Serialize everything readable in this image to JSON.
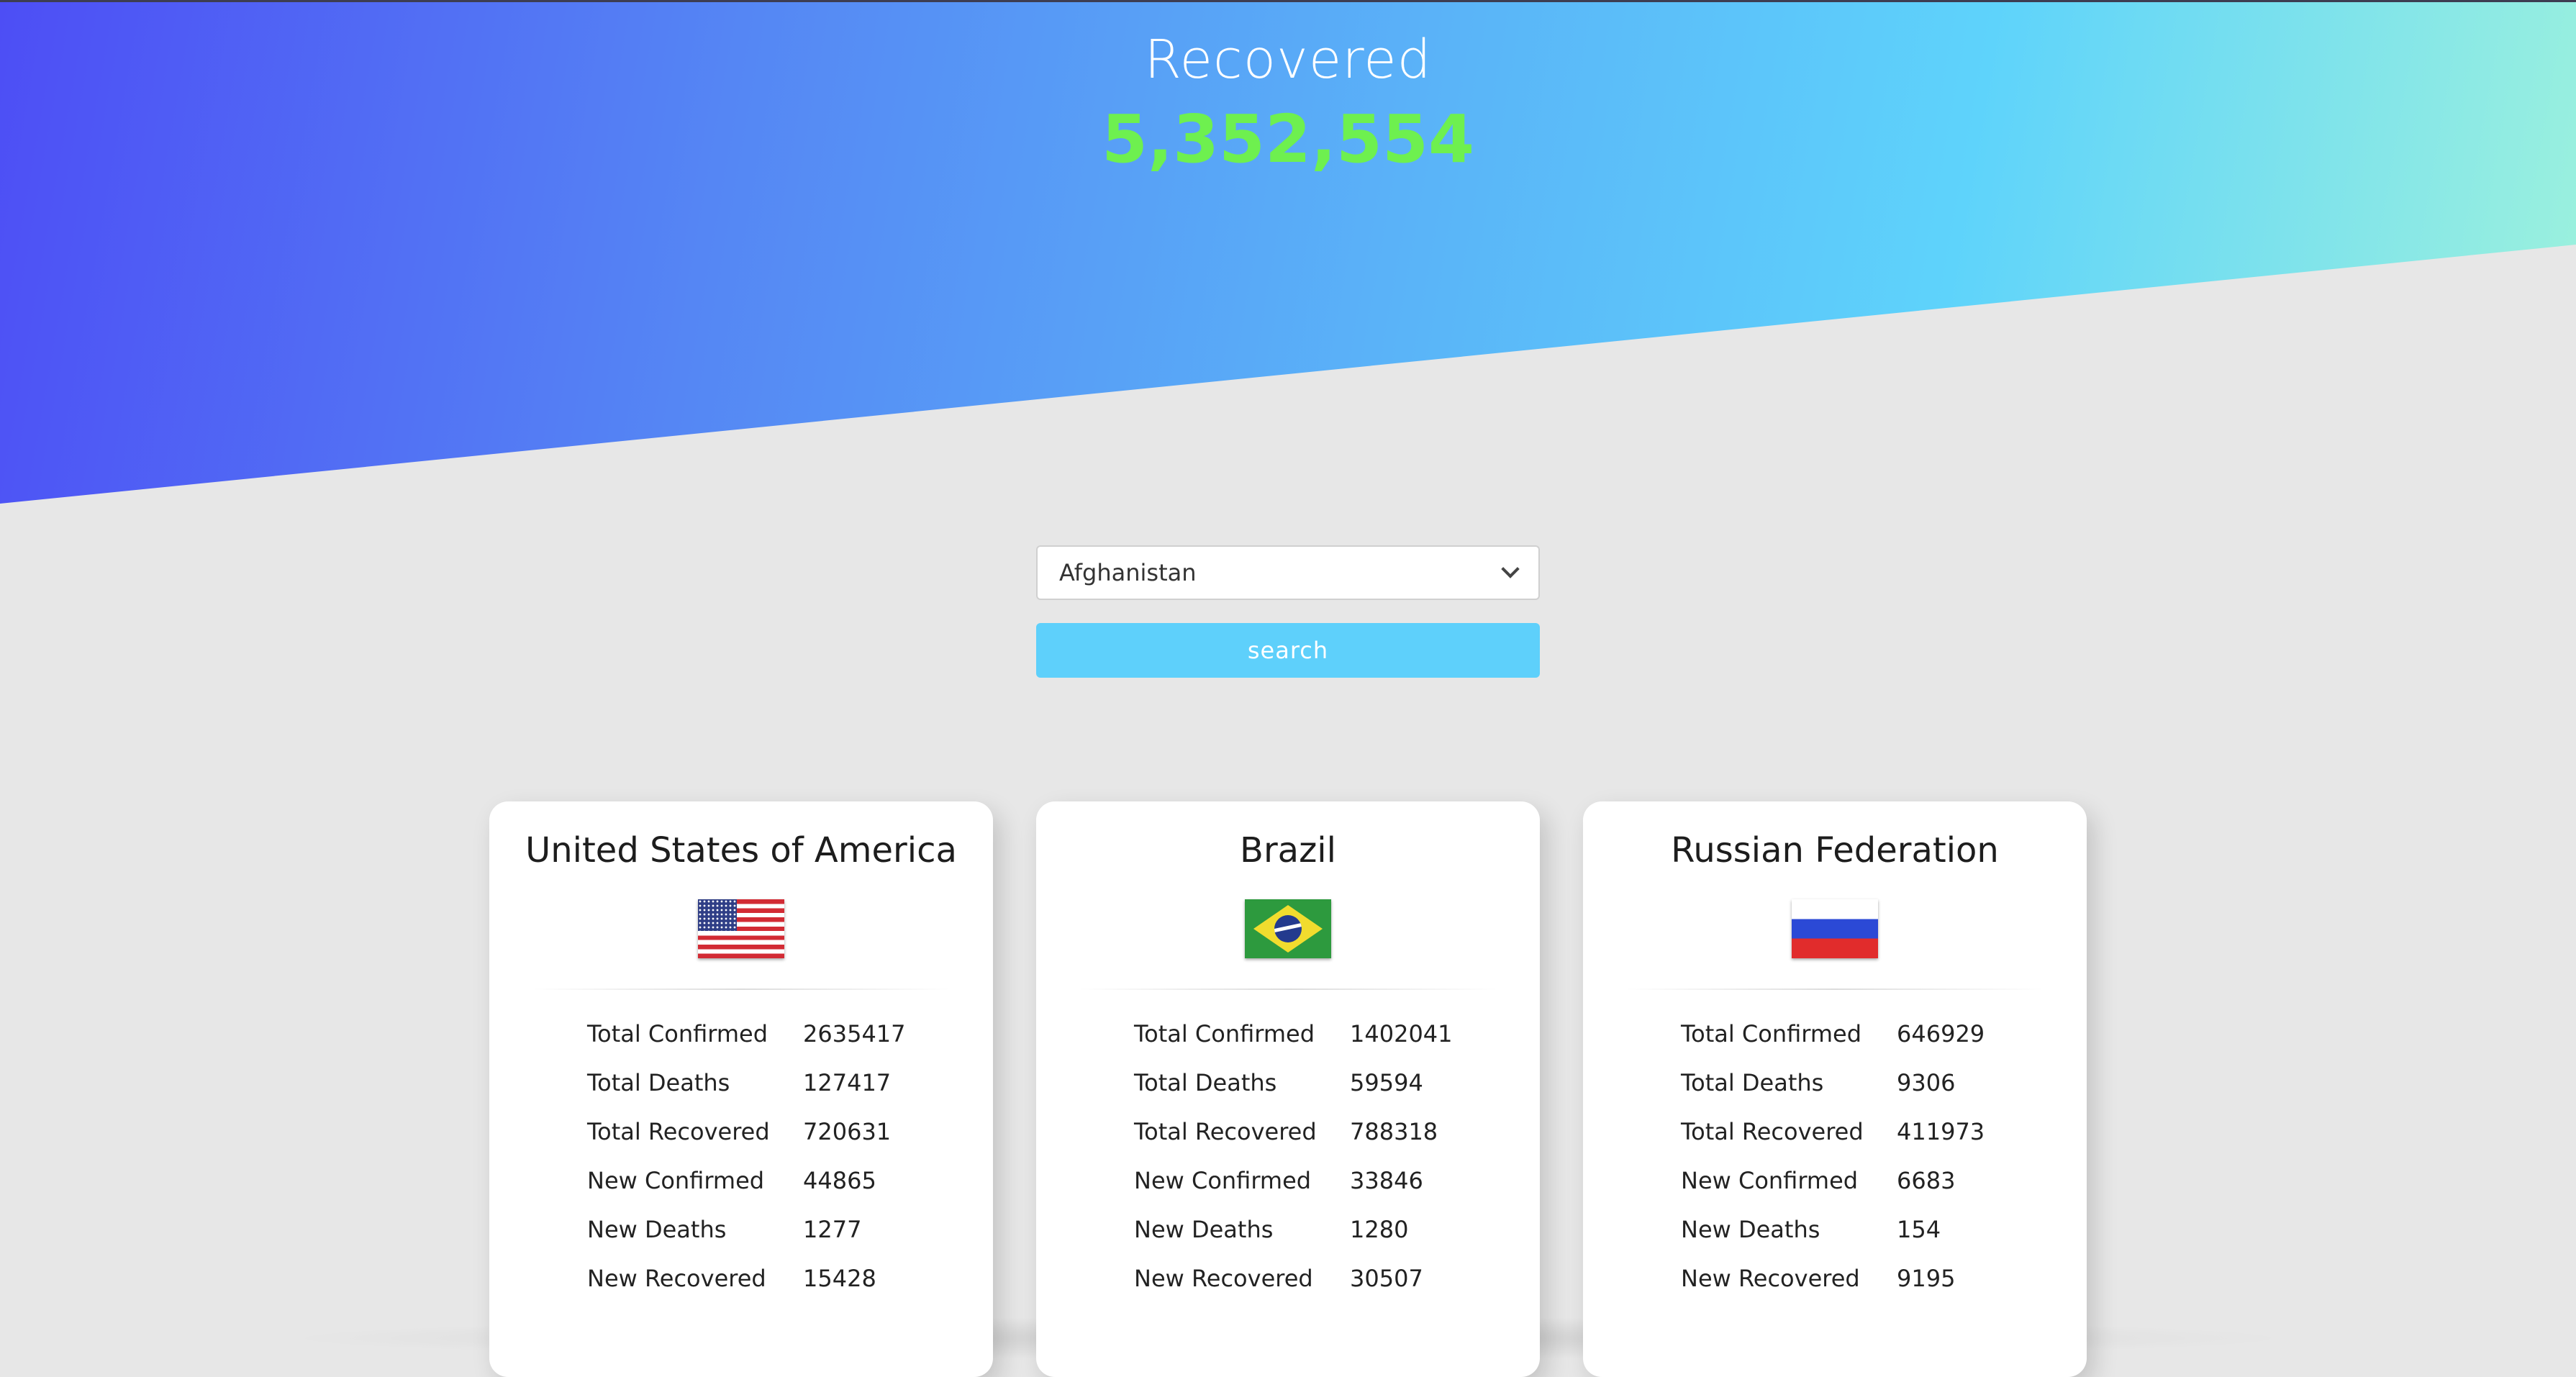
{
  "hero": {
    "label": "Recovered",
    "value": "5,352,554"
  },
  "search": {
    "selected_country": "Afghanistan",
    "button_label": "search"
  },
  "cards": [
    {
      "country": "United States of America",
      "flag_icon": "us-flag-icon",
      "stats": [
        {
          "label": "Total Confirmed",
          "value": "2635417"
        },
        {
          "label": "Total Deaths",
          "value": "127417"
        },
        {
          "label": "Total Recovered",
          "value": "720631"
        },
        {
          "label": "New Confirmed",
          "value": "44865"
        },
        {
          "label": "New Deaths",
          "value": "1277"
        },
        {
          "label": "New Recovered",
          "value": "15428"
        }
      ]
    },
    {
      "country": "Brazil",
      "flag_icon": "brazil-flag-icon",
      "stats": [
        {
          "label": "Total Confirmed",
          "value": "1402041"
        },
        {
          "label": "Total Deaths",
          "value": "59594"
        },
        {
          "label": "Total Recovered",
          "value": "788318"
        },
        {
          "label": "New Confirmed",
          "value": "33846"
        },
        {
          "label": "New Deaths",
          "value": "1280"
        },
        {
          "label": "New Recovered",
          "value": "30507"
        }
      ]
    },
    {
      "country": "Russian Federation",
      "flag_icon": "russia-flag-icon",
      "stats": [
        {
          "label": "Total Confirmed",
          "value": "646929"
        },
        {
          "label": "Total Deaths",
          "value": "9306"
        },
        {
          "label": "Total Recovered",
          "value": "411973"
        },
        {
          "label": "New Confirmed",
          "value": "6683"
        },
        {
          "label": "New Deaths",
          "value": "154"
        },
        {
          "label": "New Recovered",
          "value": "9195"
        }
      ]
    }
  ],
  "colors": {
    "hero_gradient_start": "#4d4ef5",
    "hero_gradient_end": "#9ef2dc",
    "recovered_value": "#6ef04f",
    "search_button": "#5ed0fb",
    "page_background": "#e7e7e7"
  }
}
